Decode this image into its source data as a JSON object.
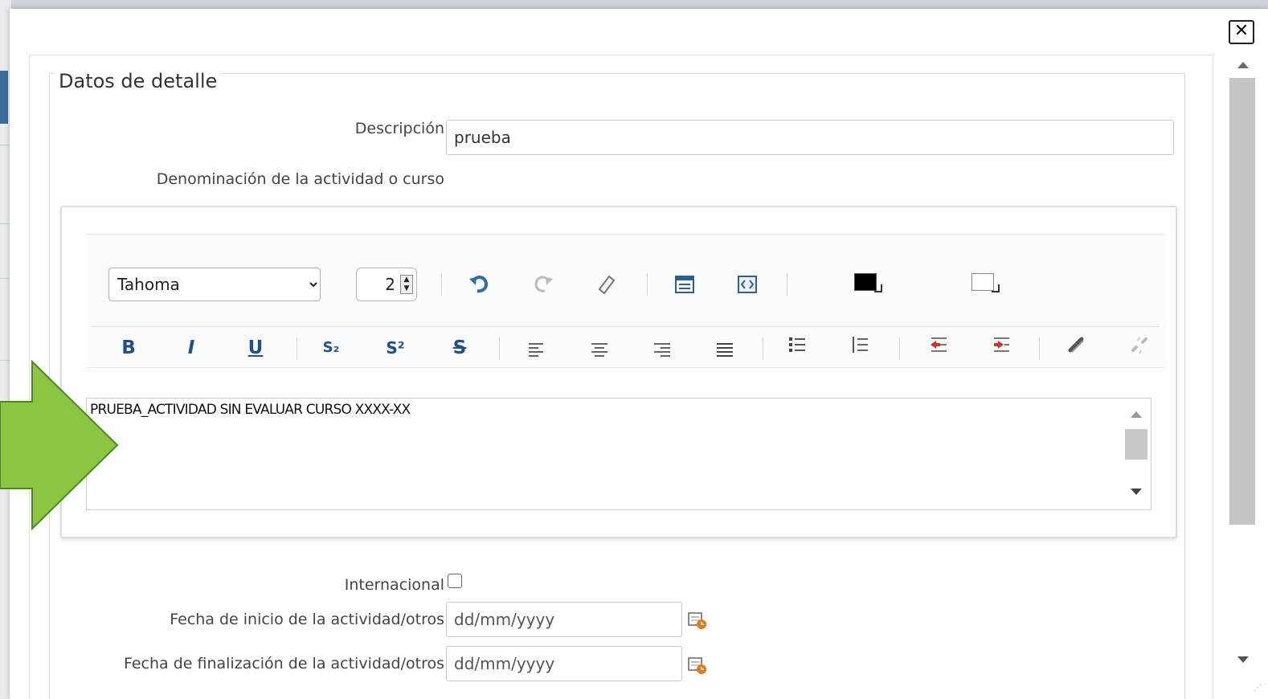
{
  "dialog": {
    "close_label": "✕"
  },
  "form": {
    "legend": "Datos de detalle",
    "descripcion_label": "Descripción",
    "descripcion_value": "prueba",
    "denominacion_label": "Denominación de la actividad o curso",
    "internacional_label": "Internacional",
    "fecha_inicio_label": "Fecha de inicio de la actividad/otros",
    "fecha_inicio_placeholder": "dd/mm/yyyy",
    "fecha_fin_label": "Fecha de finalización de la actividad/otros",
    "fecha_fin_placeholder": "dd/mm/yyyy"
  },
  "editor": {
    "font_family": "Tahoma",
    "font_options": [
      "Tahoma"
    ],
    "font_size": "2",
    "content": "PRUEBA_ACTIVIDAD SIN EVALUAR CURSO XXXX-XX",
    "toolbar_row1_icons": [
      "undo-icon",
      "redo-icon",
      "eraser-icon",
      "design-view-icon",
      "html-view-icon",
      "text-color-icon",
      "background-color-icon"
    ],
    "toolbar_row2_icons": [
      "bold-icon",
      "italic-icon",
      "underline-icon",
      "subscript-icon",
      "superscript-icon",
      "strikethrough-icon",
      "align-left-icon",
      "align-center-icon",
      "align-right-icon",
      "justify-icon",
      "bullet-list-icon",
      "numbered-list-icon",
      "outdent-icon",
      "indent-icon",
      "link-icon",
      "unlink-icon"
    ],
    "text_color": "#000000",
    "background_color": "#ffffff"
  },
  "bold_glyph": "B",
  "italic_glyph": "I",
  "underline_glyph": "U",
  "subscript_glyph": "S₂",
  "superscript_glyph": "S²",
  "strike_glyph": "S",
  "colors": {
    "accent_blue": "#1f4f8f",
    "annotation_green": "#8ac640",
    "annotation_green_border": "#4d8a1e"
  }
}
